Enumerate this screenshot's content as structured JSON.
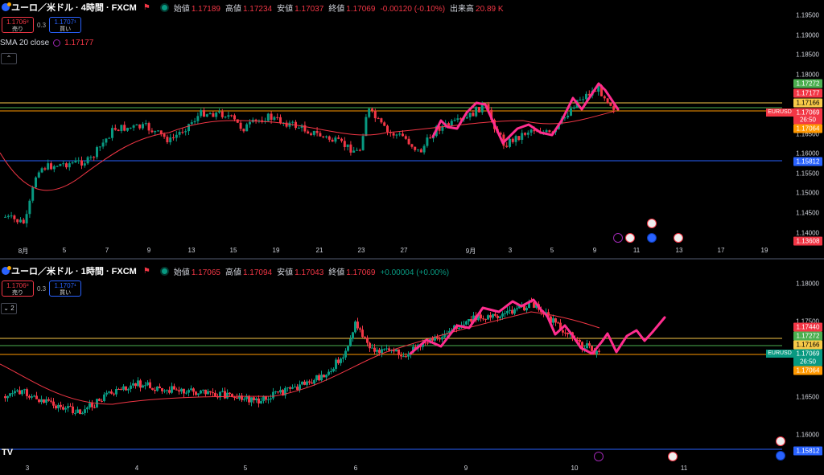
{
  "top": {
    "title": "ユーロ／米ドル · 4時間 · FXCM",
    "ohlc": [
      {
        "k": "始値",
        "v": "1.17189"
      },
      {
        "k": "高値",
        "v": "1.17234"
      },
      {
        "k": "安値",
        "v": "1.17037"
      },
      {
        "k": "終値",
        "v": "1.17069"
      },
      {
        "k": "",
        "v": "-0.00120 (-0.10%)"
      },
      {
        "k": "出来高",
        "v": "20.89 K"
      }
    ],
    "sell": {
      "price": "1.1706⁸",
      "label": "売り"
    },
    "spread": "0.3",
    "buy": {
      "price": "1.1707¹",
      "label": "買い"
    },
    "indicator": {
      "name": "SMA 20 close",
      "value": "1.17177"
    },
    "y_ticks": [
      "1.19500",
      "1.19000",
      "1.18500",
      "1.18000",
      "1.17500",
      "1.17000",
      "1.16500",
      "1.16000",
      "1.15500",
      "1.15000",
      "1.14500",
      "1.14000"
    ],
    "x_ticks": [
      "8月",
      "5",
      "7",
      "9",
      "13",
      "15",
      "19",
      "21",
      "23",
      "27",
      "9月",
      "3",
      "5",
      "9",
      "11",
      "13",
      "17",
      "19"
    ],
    "tags": [
      {
        "text": "1.17272",
        "color": "#4caf50"
      },
      {
        "text": "1.17177",
        "color": "#f23645"
      },
      {
        "text": "1.17166",
        "color": "#f7c948"
      },
      {
        "text": "1.17069",
        "color": "#f23645"
      },
      {
        "text": "26:50",
        "color": "#f23645"
      },
      {
        "text": "1.17064",
        "color": "#ff9800"
      },
      {
        "text": "1.15812",
        "color": "#2962ff"
      },
      {
        "text": "1.13608",
        "color": "#f23645"
      }
    ],
    "symbol_tag": "EURUSD"
  },
  "bottom": {
    "title": "ユーロ／米ドル · 1時間 · FXCM",
    "ohlc": [
      {
        "k": "始値",
        "v": "1.17065"
      },
      {
        "k": "高値",
        "v": "1.17094"
      },
      {
        "k": "安値",
        "v": "1.17043"
      },
      {
        "k": "終値",
        "v": "1.17069"
      },
      {
        "k": "",
        "v": "+0.00004 (+0.00%)"
      }
    ],
    "sell": {
      "price": "1.1706⁸",
      "label": "売り"
    },
    "spread": "0.3",
    "buy": {
      "price": "1.1707¹",
      "label": "買い"
    },
    "collapse_count": "2",
    "y_ticks": [
      "1.18000",
      "1.17500",
      "1.17000",
      "1.16500",
      "1.16000"
    ],
    "x_ticks": [
      "3",
      "4",
      "5",
      "6",
      "9",
      "10",
      "11"
    ],
    "tags": [
      {
        "text": "1.17440",
        "color": "#f23645"
      },
      {
        "text": "1.17272",
        "color": "#4caf50"
      },
      {
        "text": "1.17166",
        "color": "#f7c948"
      },
      {
        "text": "1.17069",
        "color": "#089981"
      },
      {
        "text": "26:50",
        "color": "#089981"
      },
      {
        "text": "1.17064",
        "color": "#ff9800"
      },
      {
        "text": "1.15812",
        "color": "#2962ff"
      }
    ],
    "symbol_tag": "EURUSD"
  },
  "colors": {
    "up": "#089981",
    "down": "#f23645",
    "sma": "#f23645",
    "drawing": "#ff2d8e",
    "support": "#2962ff",
    "level_yellow": "#f7c948",
    "level_orange": "#ff9800"
  },
  "logo": "TV"
}
